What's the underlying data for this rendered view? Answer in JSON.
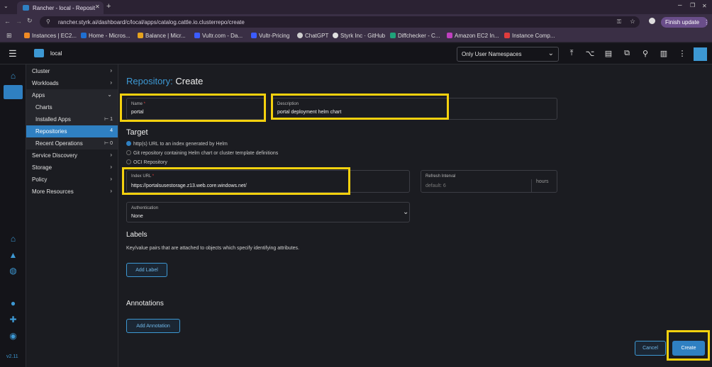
{
  "browser": {
    "tab_title": "Rancher - local - Reposit",
    "url": "rancher.styrk.ai/dashboard/c/local/apps/catalog.cattle.io.clusterrepo/create",
    "finish_update": "Finish update",
    "bookmarks": [
      {
        "label": "Instances | EC2...",
        "color": "#f08a24"
      },
      {
        "label": "Home - Micros...",
        "color": "#1f6fd1"
      },
      {
        "label": "Balance | Micr...",
        "color": "#e6a31e"
      },
      {
        "label": "Vultr.com - Da...",
        "color": "#3b5cff"
      },
      {
        "label": "Vultr-Pricing",
        "color": "#3b5cff"
      },
      {
        "label": "ChatGPT",
        "color": "#cfcfcf"
      },
      {
        "label": "Styrk Inc · GitHub",
        "color": "#e0e0e0"
      },
      {
        "label": "Diffchecker - C...",
        "color": "#1fa37a"
      },
      {
        "label": "Amazon EC2 In...",
        "color": "#c040c0"
      },
      {
        "label": "Instance Comp...",
        "color": "#e03c3c"
      }
    ]
  },
  "header": {
    "cluster": "local",
    "namespace_filter": "Only User Namespaces"
  },
  "sidebar": {
    "items": [
      {
        "label": "Cluster",
        "chevron": "›"
      },
      {
        "label": "Workloads",
        "chevron": "›"
      },
      {
        "label": "Apps",
        "chevron": "⌄"
      },
      {
        "label": "Charts"
      },
      {
        "label": "Installed Apps",
        "count": "⊢ 1"
      },
      {
        "label": "Repositories",
        "count": "4"
      },
      {
        "label": "Recent Operations",
        "count": "⊢ 0"
      },
      {
        "label": "Service Discovery",
        "chevron": "›"
      },
      {
        "label": "Storage",
        "chevron": "›"
      },
      {
        "label": "Policy",
        "chevron": "›"
      },
      {
        "label": "More Resources",
        "chevron": "›"
      }
    ],
    "version": "v2.11"
  },
  "form": {
    "title_prefix": "Repository:",
    "title_action": "Create",
    "name_label": "Name",
    "name_value": "portal",
    "description_label": "Description",
    "description_value": "portal deployment helm chart",
    "target_heading": "Target",
    "target_options": [
      "http(s) URL to an index generated by Helm",
      "Git repository containing Helm chart or cluster template definitions",
      "OCI Repository"
    ],
    "index_url_label": "Index URL",
    "index_url_value": "https://portalsusestorage.z13.web.core.windows.net/",
    "refresh_label": "Refresh Interval",
    "refresh_placeholder": "default: 6",
    "refresh_unit": "hours",
    "auth_label": "Authentication",
    "auth_value": "None",
    "labels_heading": "Labels",
    "labels_desc": "Key/value pairs that are attached to objects which specify identifying attributes.",
    "add_label": "Add Label",
    "annotations_heading": "Annotations",
    "add_annotation": "Add Annotation",
    "cancel": "Cancel",
    "create": "Create"
  },
  "colors": {
    "accent": "#2f80c2",
    "highlight": "#f5d10e"
  }
}
